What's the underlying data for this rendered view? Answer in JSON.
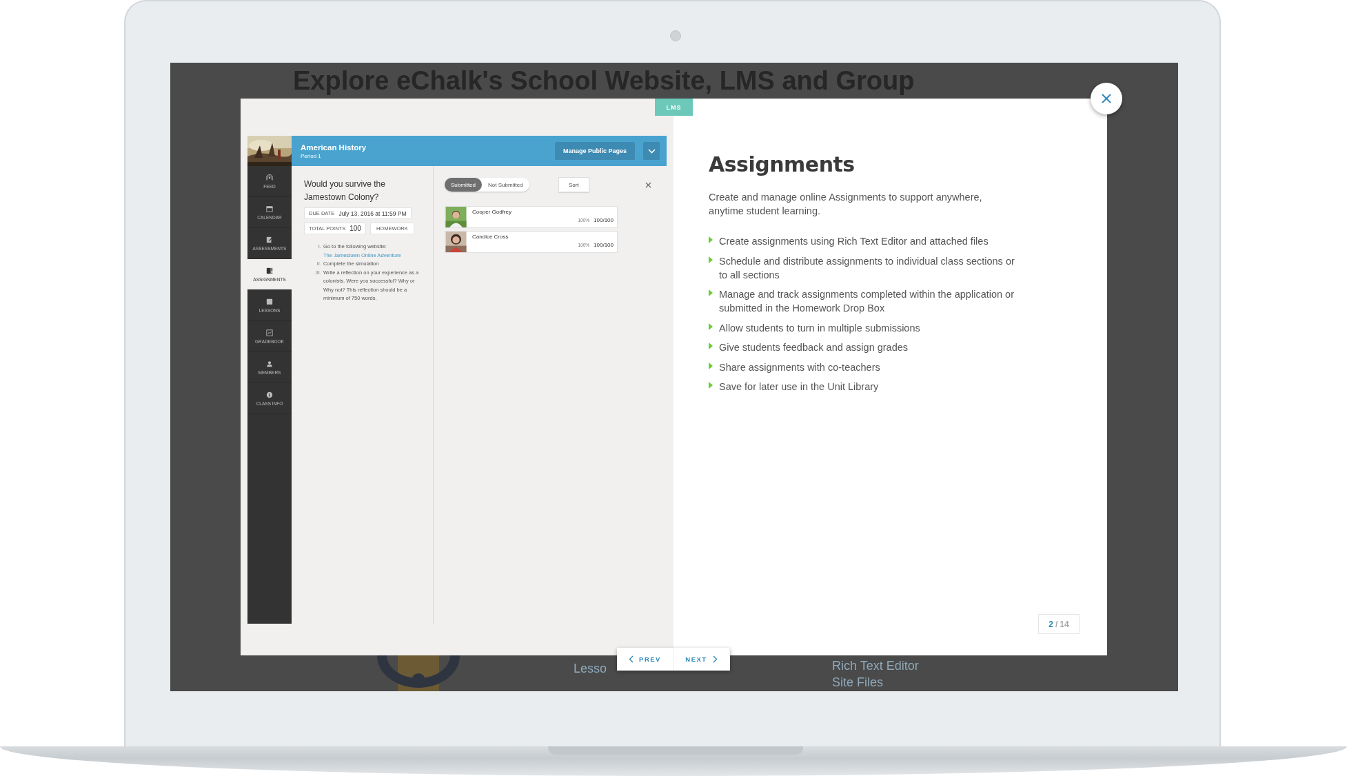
{
  "background_page": {
    "heading": "Explore eChalk's School Website, LMS and Group",
    "texts": [
      "Lesso",
      "Rich Text Editor",
      "Site Files"
    ]
  },
  "modal": {
    "tag": "LMS"
  },
  "app": {
    "class_title": "American History",
    "class_period": "Period 1",
    "manage_button": "Manage Public Pages",
    "nav": [
      {
        "label": "FEED",
        "kind": "feed",
        "selected": false
      },
      {
        "label": "CALENDAR",
        "kind": "calendar",
        "selected": false
      },
      {
        "label": "ASSESSMENTS",
        "kind": "assessments",
        "selected": false
      },
      {
        "label": "ASSIGNMENTS",
        "kind": "assignments",
        "selected": true
      },
      {
        "label": "LESSONS",
        "kind": "lessons",
        "selected": false
      },
      {
        "label": "GRADEBOOK",
        "kind": "gradebook",
        "selected": false
      },
      {
        "label": "MEMBERS",
        "kind": "members",
        "selected": false
      },
      {
        "label": "CLASS INFO",
        "kind": "info",
        "selected": false
      }
    ],
    "assignment": {
      "title": "Would you survive the Jamestown Colony?",
      "due_label": "DUE DATE",
      "due_value": "July 13, 2016 at 11:59 PM",
      "points_label": "TOTAL POINTS",
      "points_value": "100",
      "type_tag": "HOMEWORK",
      "steps": [
        {
          "marker": "I.",
          "text": "Go to the following website: ",
          "link": "The Jamestown Online Adventure"
        },
        {
          "marker": "II.",
          "text": "Complete the simulation"
        },
        {
          "marker": "III.",
          "text": "Write a reflection on your experience as a colonists.  Were you successful? Why or Why not?  This reflection should be a minimum of 750 words."
        }
      ]
    },
    "filter_tabs": [
      {
        "label": "Submitted",
        "selected": true
      },
      {
        "label": "Not Submitted",
        "selected": false
      }
    ],
    "sort_button": "Sort",
    "submissions": [
      {
        "name": "Cooper Godfrey",
        "percent": "100%",
        "score": "100/100",
        "kind": "picture"
      },
      {
        "name": "Candice Cross",
        "percent": "100%",
        "score": "100/100",
        "kind": "picture"
      }
    ]
  },
  "feature": {
    "title": "Assignments",
    "description": "Create and manage online Assignments to support anywhere, anytime student learning.",
    "bullets": [
      "Create assignments using Rich Text Editor and attached files",
      "Schedule and distribute assignments to individual class sections or to all sections",
      "Manage and track assignments completed within the application or submitted in the Homework Drop Box",
      "Allow students to turn in multiple submissions",
      "Give students feedback and assign grades",
      "Share assignments with co-teachers",
      "Save for later use in the Unit Library"
    ]
  },
  "pager": {
    "current": "2",
    "separator": "/",
    "total": "14"
  },
  "nav_buttons": {
    "prev": "PREV",
    "next": "NEXT"
  }
}
